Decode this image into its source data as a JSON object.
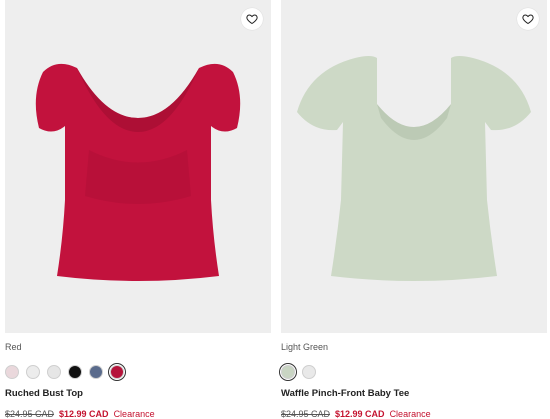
{
  "products": [
    {
      "color_label": "Red",
      "name": "Ruched Bust Top",
      "original_price": "$24.95 CAD",
      "sale_price": "$12.99 CAD",
      "badge": "Clearance",
      "garment_color": "#c2123d",
      "swatches": [
        "#ead8dc",
        "#ececec",
        "#e6e6e6",
        "#111111",
        "#5a6b8c",
        "#b5143b"
      ],
      "selected_swatch": 5
    },
    {
      "color_label": "Light Green",
      "name": "Waffle Pinch-Front Baby Tee",
      "original_price": "$24.95 CAD",
      "sale_price": "$12.99 CAD",
      "badge": "Clearance",
      "garment_color": "#cdd9c6",
      "swatches": [
        "#c9d5c3",
        "#e9e9e9"
      ],
      "selected_swatch": 0
    }
  ],
  "icons": {
    "favorite": "heart-outline-icon"
  },
  "colors": {
    "sale": "#c4122f",
    "image_bg": "#eeeeee"
  }
}
